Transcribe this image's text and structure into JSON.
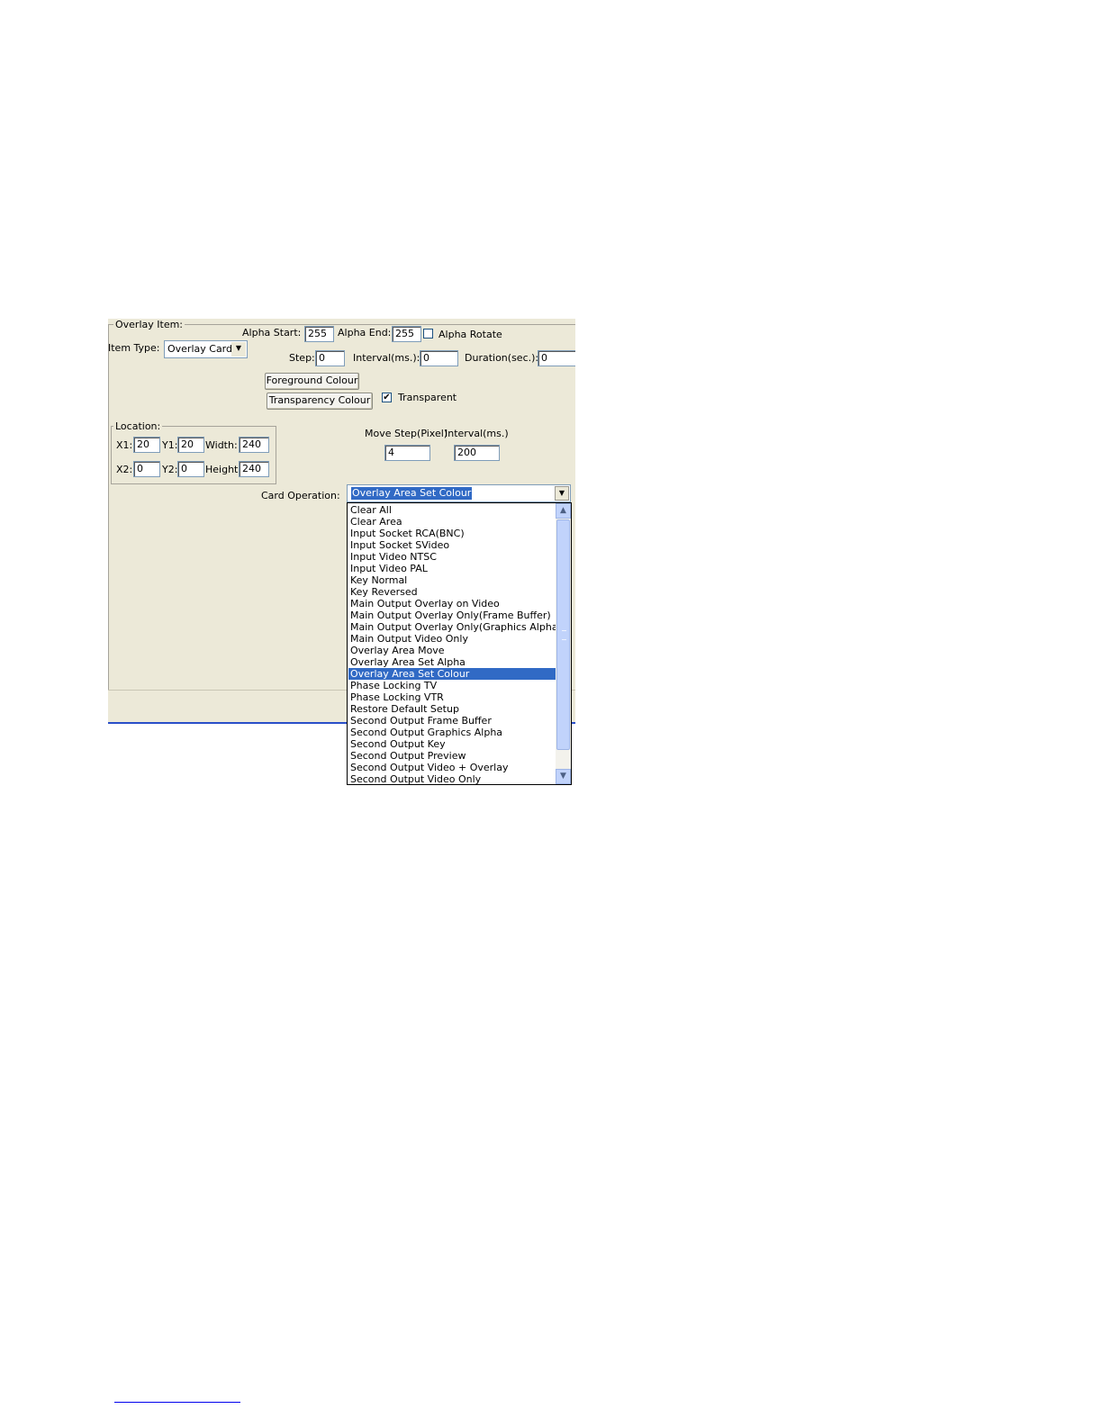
{
  "overlay_group": {
    "label": "Overlay Item:"
  },
  "item_type": {
    "label": "Item Type:",
    "value": "Overlay Card"
  },
  "alpha": {
    "start_label": "Alpha Start:",
    "start_value": "255",
    "end_label": "Alpha End:",
    "end_value": "255",
    "rotate_label": "Alpha Rotate",
    "rotate_checked": false
  },
  "timing": {
    "step_label": "Step:",
    "step_value": "0",
    "interval_label": "Interval(ms.):",
    "interval_value": "0",
    "duration_label": "Duration(sec.):",
    "duration_value": "0"
  },
  "colours": {
    "foreground_label": "Foreground Colour",
    "transparency_label": "Transparency Colour",
    "transparent_label": "Transparent",
    "transparent_checked": true,
    "check_mark": "✔"
  },
  "location": {
    "label": "Location:",
    "x1_label": "X1:",
    "x1_value": "20",
    "y1_label": "Y1:",
    "y1_value": "20",
    "width_label": "Width:",
    "width_value": "240",
    "x2_label": "X2:",
    "x2_value": "0",
    "y2_label": "Y2:",
    "y2_value": "0",
    "height_label": "Height:",
    "height_value": "240"
  },
  "move": {
    "step_label": "Move Step(Pixel)",
    "step_value": "4",
    "interval_label": "Interval(ms.)",
    "interval_value": "200"
  },
  "card_operation": {
    "label": "Card Operation:",
    "value": "Overlay Area Set Colour",
    "options": [
      "Clear All",
      "Clear Area",
      "Input Socket RCA(BNC)",
      "Input Socket SVideo",
      "Input Video NTSC",
      "Input Video PAL",
      "Key Normal",
      "Key Reversed",
      "Main Output Overlay on Video",
      "Main Output Overlay Only(Frame Buffer)",
      "Main Output Overlay Only(Graphics Alpha)",
      "Main Output Video Only",
      "Overlay Area Move",
      "Overlay Area Set Alpha",
      "Overlay Area Set Colour",
      "Phase Locking TV",
      "Phase Locking VTR",
      "Restore Default Setup",
      "Second Output Frame Buffer",
      "Second Output Graphics Alpha",
      "Second Output Key",
      "Second Output Preview",
      "Second Output Video + Overlay",
      "Second Output Video Only"
    ],
    "selected_index": 14
  },
  "icons": {
    "dropdown_arrow": "▼",
    "scroll_up": "▲",
    "scroll_down": "▼"
  },
  "colors": {
    "dialog_bg": "#ece9d8",
    "selection_bg": "#316ac5",
    "scroll_thumb": "#c1d3fb",
    "accent_line": "#2a4fc8"
  }
}
